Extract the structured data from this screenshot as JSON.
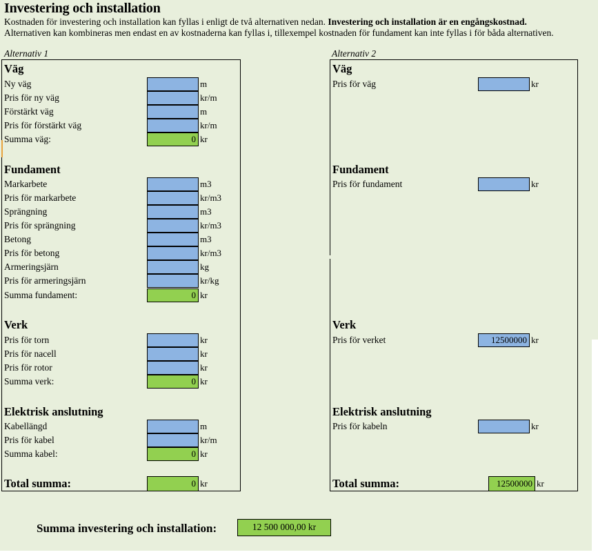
{
  "page": {
    "title": "Investering och installation",
    "intro_line_1_plain": "Kostnaden för investering och installation kan fyllas i enligt de två alternativen nedan. ",
    "intro_line_1_bold": "Investering och installation är en engångskostnad.",
    "intro_line_2": "Alternativen kan kombineras men endast en av kostnaderna kan fyllas i, tillexempel kostnaden för fundament kan inte fyllas i för båda alternativen.",
    "background_color": "#E8EFDC",
    "input_cell_color": "#8DB4E2",
    "sum_cell_color": "#92D050",
    "accent_color": "#E8A33D"
  },
  "alt1": {
    "caption": "Alternativ 1",
    "sections": [
      {
        "heading": "Väg",
        "rows": [
          {
            "label": "Ny väg",
            "value": "",
            "unit": "m",
            "type": "input"
          },
          {
            "label": "Pris för ny väg",
            "value": "",
            "unit": "kr/m",
            "type": "input"
          },
          {
            "label": "Förstärkt väg",
            "value": "",
            "unit": "m",
            "type": "input"
          },
          {
            "label": "Pris för förstärkt väg",
            "value": "",
            "unit": "kr/m",
            "type": "input"
          },
          {
            "label": "Summa väg:",
            "value": "0",
            "unit": "kr",
            "type": "sum"
          }
        ]
      },
      {
        "heading": "Fundament",
        "rows": [
          {
            "label": "Markarbete",
            "value": "",
            "unit": "m3",
            "type": "input"
          },
          {
            "label": "Pris för markarbete",
            "value": "",
            "unit": "kr/m3",
            "type": "input"
          },
          {
            "label": "Sprängning",
            "value": "",
            "unit": "m3",
            "type": "input"
          },
          {
            "label": "Pris för sprängning",
            "value": "",
            "unit": "kr/m3",
            "type": "input"
          },
          {
            "label": "Betong",
            "value": "",
            "unit": "m3",
            "type": "input"
          },
          {
            "label": "Pris för betong",
            "value": "",
            "unit": "kr/m3",
            "type": "input"
          },
          {
            "label": "Armeringsjärn",
            "value": "",
            "unit": "kg",
            "type": "input"
          },
          {
            "label": "Pris för armeringsjärn",
            "value": "",
            "unit": "kr/kg",
            "type": "input"
          },
          {
            "label": "Summa fundament:",
            "value": "0",
            "unit": "kr",
            "type": "sum"
          }
        ]
      },
      {
        "heading": "Verk",
        "rows": [
          {
            "label": "Pris för torn",
            "value": "",
            "unit": "kr",
            "type": "input"
          },
          {
            "label": "Pris för nacell",
            "value": "",
            "unit": "kr",
            "type": "input"
          },
          {
            "label": "Pris för rotor",
            "value": "",
            "unit": "kr",
            "type": "input"
          },
          {
            "label": "Summa verk:",
            "value": "0",
            "unit": "kr",
            "type": "sum"
          }
        ]
      },
      {
        "heading": "Elektrisk anslutning",
        "rows": [
          {
            "label": "Kabellängd",
            "value": "",
            "unit": "m",
            "type": "input"
          },
          {
            "label": "Pris för kabel",
            "value": "",
            "unit": "kr/m",
            "type": "input"
          },
          {
            "label": "Summa kabel:",
            "value": "0",
            "unit": "kr",
            "type": "sum"
          }
        ]
      }
    ],
    "total": {
      "label": "Total summa:",
      "value": "0",
      "unit": "kr"
    }
  },
  "alt2": {
    "caption": "Alternativ 2",
    "sections": [
      {
        "heading": "Väg",
        "rows": [
          {
            "label": "Pris för väg",
            "value": "",
            "unit": "kr",
            "type": "input"
          }
        ]
      },
      {
        "heading": "Fundament",
        "rows": [
          {
            "label": "Pris för fundament",
            "value": "",
            "unit": "kr",
            "type": "input"
          }
        ]
      },
      {
        "heading": "Verk",
        "rows": [
          {
            "label": "Pris för verket",
            "value": "12500000",
            "unit": "kr",
            "type": "input"
          }
        ]
      },
      {
        "heading": "Elektrisk anslutning",
        "rows": [
          {
            "label": "Pris för kabeln",
            "value": "",
            "unit": "kr",
            "type": "input"
          }
        ]
      }
    ],
    "total": {
      "label": "Total summa:",
      "value": "12500000",
      "unit": "kr"
    }
  },
  "grand_total": {
    "label": "Summa investering och installation:",
    "value": "12 500 000,00 kr"
  }
}
